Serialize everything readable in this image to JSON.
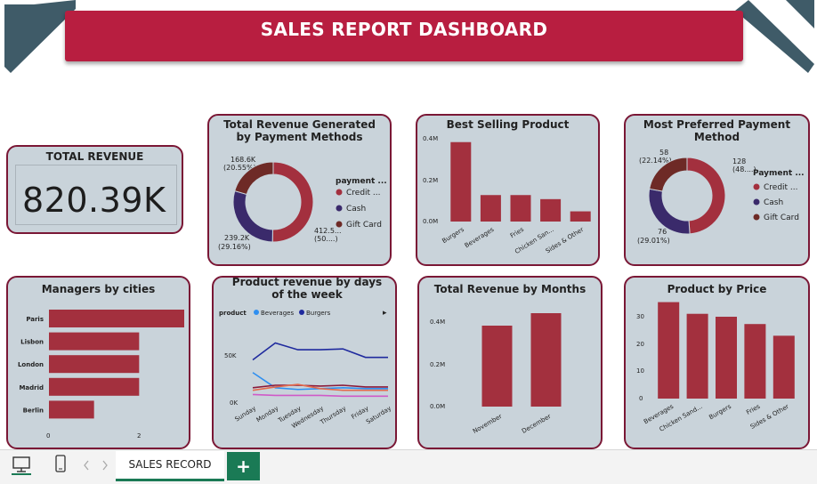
{
  "header": {
    "title": "SALES REPORT DASHBOARD"
  },
  "kpi": {
    "label": "TOTAL REVENUE",
    "value": "820.39K"
  },
  "colors": {
    "banner": "#b81e40",
    "bar": "#a3303e",
    "card_bg": "#c9d3da",
    "card_border": "#7a1735",
    "accent_green": "#1a7a55",
    "credit": "#a3303e",
    "cash": "#3a2a6b",
    "gift": "#6e2a26"
  },
  "donut_revenue": {
    "title": "Total Revenue Generated by Payment Methods",
    "legend_title": "payment ...",
    "legend": [
      "Credit ...",
      "Cash",
      "Gift Card"
    ],
    "labels": {
      "gift": "168.6K",
      "gift_pct": "(20.55%)",
      "cash": "239.2K",
      "cash_pct": "(29.16%)",
      "credit": "412.5...",
      "credit_pct": "(50....)"
    }
  },
  "best_selling": {
    "title": "Best Selling Product",
    "yticks": [
      "0.4M",
      "0.2M",
      "0.0M"
    ]
  },
  "payment_pref": {
    "title": "Most Preferred Payment Method",
    "legend_title": "Payment ...",
    "legend": [
      "Credit ...",
      "Cash",
      "Gift Card"
    ],
    "labels": {
      "gift": "58",
      "gift_pct": "(22.14%)",
      "credit": "128",
      "credit_pct": "(48....)",
      "cash": "76",
      "cash_pct": "(29.01%)"
    }
  },
  "managers": {
    "title": "Managers by cities",
    "xticks": [
      "0",
      "2"
    ]
  },
  "days": {
    "title": "Product revenue by days of the week",
    "legend_label": "product",
    "legend": [
      "Beverages",
      "Burgers"
    ],
    "yticks": [
      "50K",
      "0K"
    ],
    "more_icon": "▸"
  },
  "months": {
    "title": "Total Revenue by Months",
    "yticks": [
      "0.4M",
      "0.2M",
      "0.0M"
    ]
  },
  "price": {
    "title": "Product by Price",
    "yticks": [
      "30",
      "20",
      "10",
      "0"
    ]
  },
  "bottom": {
    "sheet_tab": "SALES RECORD",
    "add_label": "+",
    "icons": [
      "desktop-icon",
      "mobile-icon",
      "nav-prev-icon",
      "nav-next-icon"
    ]
  },
  "chart_data": [
    {
      "type": "pie",
      "title": "Total Revenue Generated by Payment Methods",
      "categories": [
        "Credit Card",
        "Cash",
        "Gift Card"
      ],
      "values": [
        412.5,
        239.2,
        168.6
      ],
      "unit": "K"
    },
    {
      "type": "bar",
      "title": "Best Selling Product",
      "categories": [
        "Burgers",
        "Beverages",
        "Fries",
        "Chicken San...",
        "Sides & Other"
      ],
      "values": [
        0.39,
        0.13,
        0.13,
        0.11,
        0.05
      ],
      "ylim": [
        0,
        0.45
      ],
      "unit": "M"
    },
    {
      "type": "pie",
      "title": "Most Preferred Payment Method",
      "categories": [
        "Credit Card",
        "Cash",
        "Gift Card"
      ],
      "values": [
        128,
        76,
        58
      ]
    },
    {
      "type": "bar",
      "title": "Managers by cities",
      "categories": [
        "Paris",
        "Lisbon",
        "London",
        "Madrid",
        "Berlin"
      ],
      "values": [
        3,
        2,
        2,
        2,
        1
      ],
      "orientation": "horizontal",
      "xlim": [
        0,
        3
      ]
    },
    {
      "type": "line",
      "title": "Product revenue by days of the week",
      "x": [
        "Sunday",
        "Monday",
        "Tuesday",
        "Wednesday",
        "Thursday",
        "Friday",
        "Saturday"
      ],
      "ylim": [
        0,
        100
      ],
      "series": [
        {
          "name": "Beverages",
          "color": "#2f8ff0",
          "values": [
            35,
            17,
            15,
            16,
            17,
            16,
            16
          ]
        },
        {
          "name": "Burgers",
          "color": "#1f2a9e",
          "values": [
            50,
            70,
            62,
            62,
            63,
            53,
            53
          ]
        },
        {
          "color": "#8b1a3a",
          "values": [
            17,
            20,
            20,
            19,
            20,
            18,
            18
          ]
        },
        {
          "color": "#e46a4c",
          "values": [
            14,
            18,
            21,
            16,
            14,
            14,
            14
          ]
        },
        {
          "color": "#d05ac8",
          "values": [
            9,
            8,
            8,
            8,
            7,
            7,
            7
          ]
        }
      ]
    },
    {
      "type": "bar",
      "title": "Total Revenue by Months",
      "categories": [
        "November",
        "December"
      ],
      "values": [
        0.39,
        0.45
      ],
      "ylim": [
        0,
        0.6
      ],
      "unit": "M"
    },
    {
      "type": "bar",
      "title": "Product by Price",
      "categories": [
        "Beverages",
        "Chicken Sand...",
        "Burgers",
        "Fries",
        "Sides & Other"
      ],
      "values": [
        33,
        29,
        28,
        25.5,
        21.5
      ],
      "ylim": [
        0,
        35
      ]
    }
  ]
}
